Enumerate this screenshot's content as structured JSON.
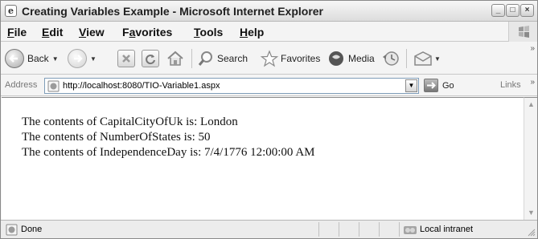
{
  "window": {
    "title": "Creating Variables Example - Microsoft Internet Explorer",
    "title_icon": "e",
    "minimize_glyph": "_",
    "maximize_glyph": "□",
    "close_glyph": "×"
  },
  "menu": {
    "items": [
      {
        "key": "F",
        "rest": "ile"
      },
      {
        "key": "E",
        "rest": "dit"
      },
      {
        "key": "V",
        "rest": "iew"
      },
      {
        "key": "a",
        "prefix": "F",
        "rest": "vorites"
      },
      {
        "key": "T",
        "rest": "ools"
      },
      {
        "key": "H",
        "rest": "elp"
      }
    ]
  },
  "toolbar": {
    "back_label": "Back",
    "search_label": "Search",
    "favorites_label": "Favorites",
    "media_label": "Media",
    "overflow_glyph": "»",
    "dropdown_glyph": "▼"
  },
  "address": {
    "label": "Address",
    "url": "http://localhost:8080/TIO-Variable1.aspx",
    "go_label": "Go",
    "links_label": "Links",
    "overflow_glyph": "»",
    "dropdown_glyph": "▼"
  },
  "content": {
    "lines": [
      "The contents of CapitalCityOfUk is: London",
      "The contents of NumberOfStates is: 50",
      "The contents of IndependenceDay is: 7/4/1776 12:00:00 AM"
    ]
  },
  "status": {
    "text": "Done",
    "zone": "Local intranet"
  },
  "colors": {
    "address_border": "#7f9db9",
    "window_background": "#f4f4f4",
    "content_background": "#ffffff"
  }
}
